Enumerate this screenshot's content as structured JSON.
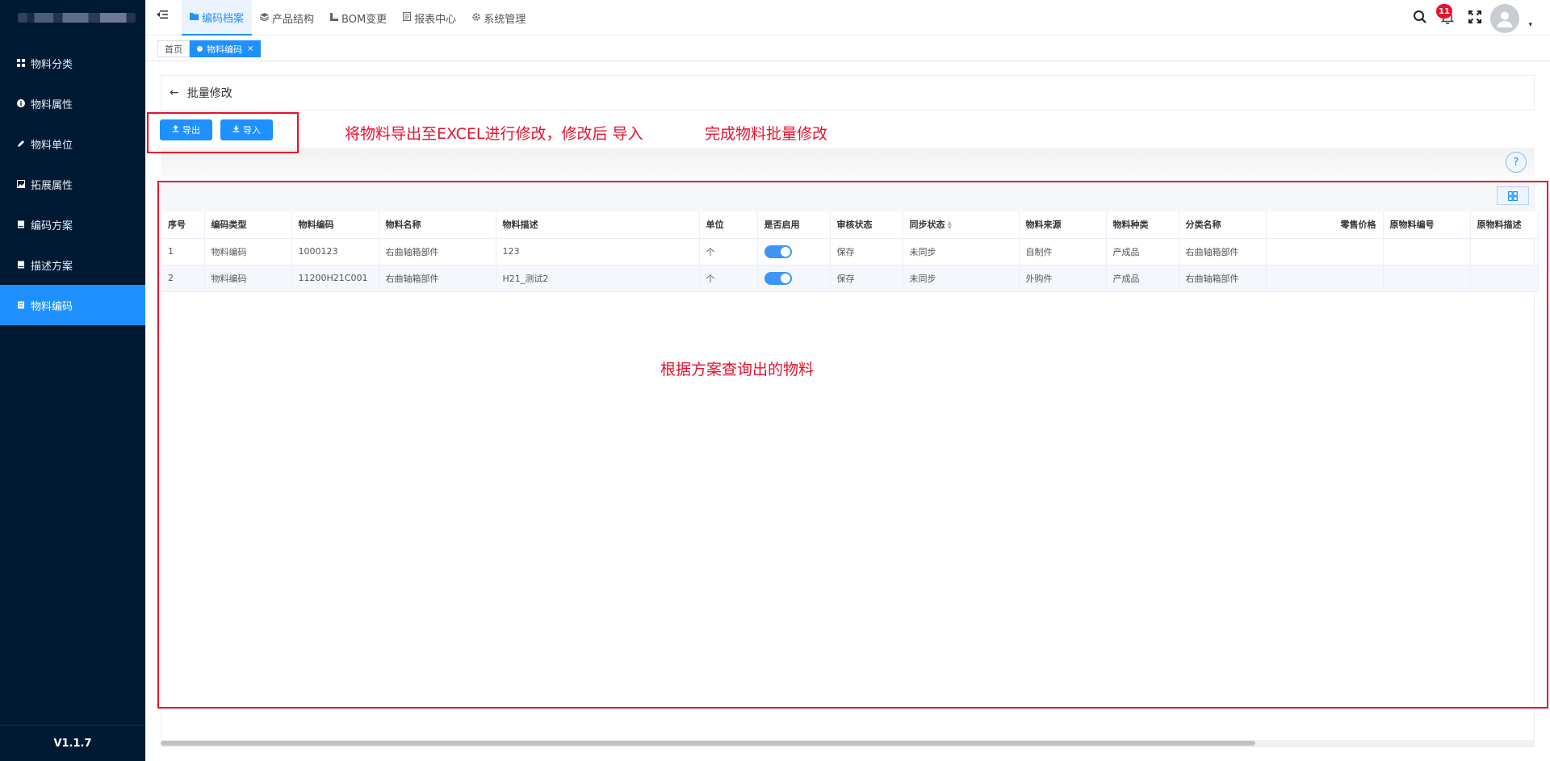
{
  "sidebar": {
    "items": [
      {
        "label": "物料分类",
        "icon": "grid-icon"
      },
      {
        "label": "物料属性",
        "icon": "info-icon"
      },
      {
        "label": "物料单位",
        "icon": "pen-icon"
      },
      {
        "label": "拓展属性",
        "icon": "image-icon"
      },
      {
        "label": "编码方案",
        "icon": "book-icon"
      },
      {
        "label": "描述方案",
        "icon": "book-icon"
      },
      {
        "label": "物料编码",
        "icon": "code-icon"
      }
    ],
    "active_index": 6,
    "version": "V1.1.7"
  },
  "topnav": {
    "items": [
      {
        "label": "编码档案",
        "icon": "folder-icon"
      },
      {
        "label": "产品结构",
        "icon": "layers-icon"
      },
      {
        "label": "BOM变更",
        "icon": "hierarchy-icon"
      },
      {
        "label": "报表中心",
        "icon": "report-icon"
      },
      {
        "label": "系统管理",
        "icon": "gear-icon"
      }
    ],
    "notification_count": "11"
  },
  "tabs": {
    "home": "首页",
    "current": "物料编码",
    "close": "×"
  },
  "page": {
    "back_arrow": "←",
    "title": "批量修改",
    "export_label": "导出",
    "import_label": "导入",
    "help": "?"
  },
  "table": {
    "columns": [
      "序号",
      "编码类型",
      "物料编码",
      "物料名称",
      "物料描述",
      "单位",
      "是否启用",
      "审核状态",
      "同步状态",
      "物料来源",
      "物料种类",
      "分类名称",
      "零售价格",
      "原物料编号",
      "原物料描述"
    ],
    "rows": [
      [
        "1",
        "物料编码",
        "1000123",
        "右曲轴箱部件",
        "123",
        "个",
        "",
        "保存",
        "未同步",
        "自制件",
        "产成品",
        "右曲轴箱部件",
        "",
        "",
        ""
      ],
      [
        "2",
        "物料编码",
        "11200H21C001",
        "右曲轴箱部件",
        "H21_测试2",
        "个",
        "",
        "保存",
        "未同步",
        "外购件",
        "产成品",
        "右曲轴箱部件",
        "",
        "",
        ""
      ]
    ],
    "enabled": [
      true,
      true
    ]
  },
  "annotations": {
    "export_note": "将物料导出至EXCEL进行修改，修改后 导入",
    "finish_note": "完成物料批量修改",
    "query_note": "根据方案查询出的物料",
    "color": "#e8112d"
  },
  "colors": {
    "sidebar_bg": "#001a33",
    "accent": "#1e90ff"
  }
}
